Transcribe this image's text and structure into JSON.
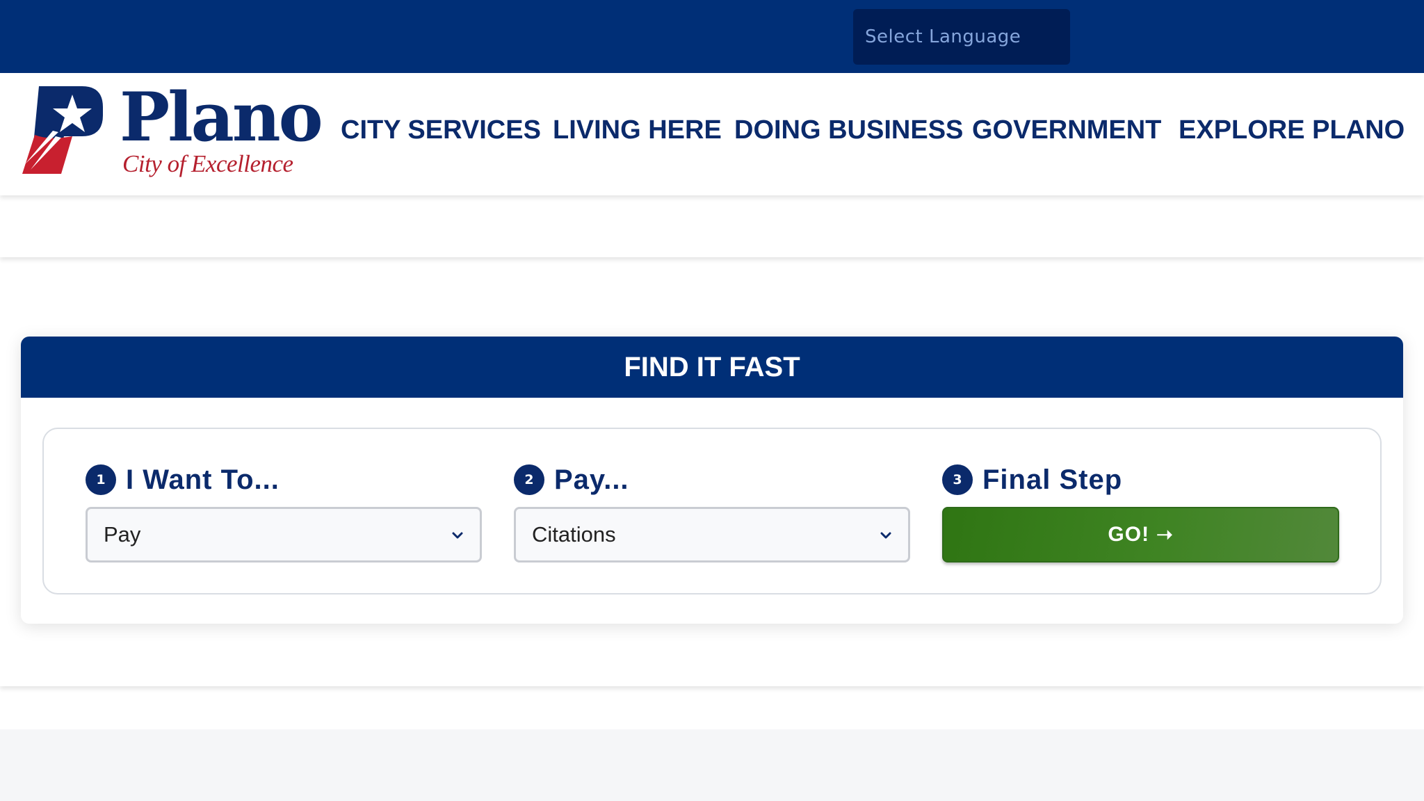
{
  "top_bar": {
    "language_select": "Select Language"
  },
  "header": {
    "logo": {
      "wordmark": "Plano",
      "tagline": "City of Excellence"
    },
    "nav": [
      {
        "label": "CITY SERVICES"
      },
      {
        "label": "LIVING HERE"
      },
      {
        "label": "DOING BUSINESS"
      },
      {
        "label": "GOVERNMENT"
      },
      {
        "label": "EXPLORE PLANO"
      }
    ]
  },
  "find_it_fast": {
    "title": "FIND IT FAST",
    "steps": [
      {
        "number": "1",
        "label": "I Want To...",
        "value": "Pay"
      },
      {
        "number": "2",
        "label": "Pay...",
        "value": "Citations"
      },
      {
        "number": "3",
        "label": "Final Step"
      }
    ],
    "go_label": "GO!",
    "go_icon": "arrow-right-icon"
  },
  "colors": {
    "navy": "#002f77",
    "brand_text": "#0b2a6b",
    "brand_red": "#b5202e",
    "go_green": "#3f8423"
  }
}
